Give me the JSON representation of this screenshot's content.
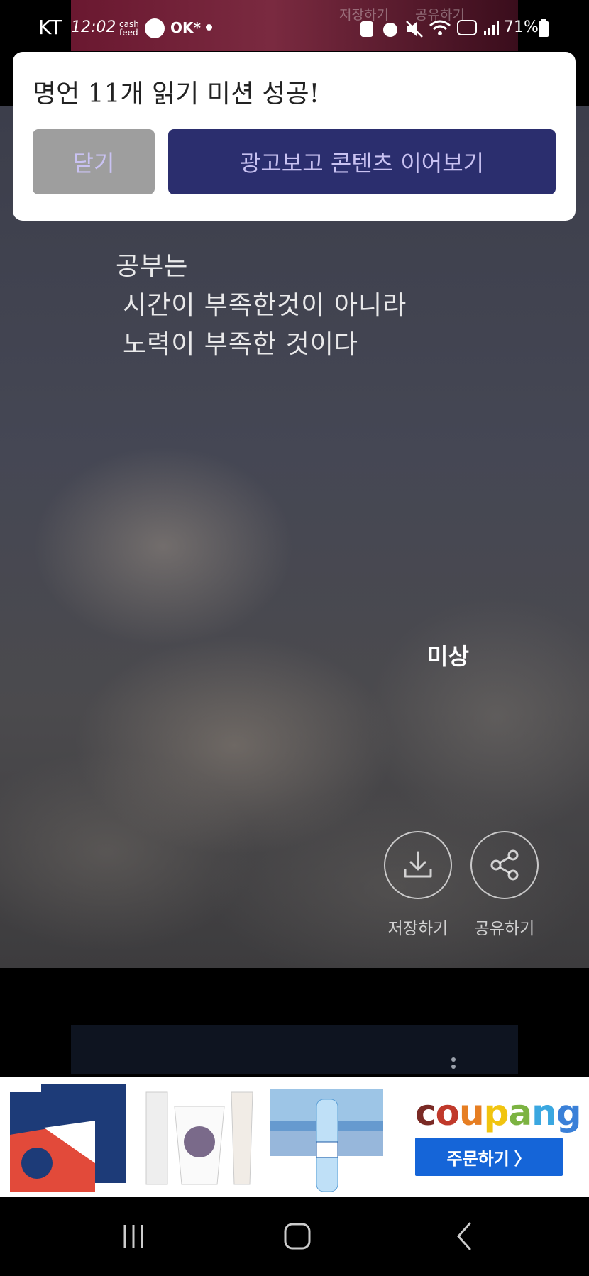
{
  "status_bar": {
    "carrier": "KT",
    "time": "12:02",
    "battery": "71%",
    "icons": [
      "cashfeed-icon",
      "ollock-icon",
      "ok-icon",
      "dot-icon",
      "download-icon",
      "alarm-icon",
      "mute-icon",
      "wifi-icon",
      "hd-icon",
      "signal-icon",
      "battery-icon"
    ]
  },
  "background_strip": {
    "save_label": "저장하기",
    "share_label": "공유하기"
  },
  "dialog": {
    "title": "명언 11개 읽기 미션 성공!",
    "close_label": "닫기",
    "ad_label": "광고보고 콘텐츠 이어보기"
  },
  "quote": {
    "lines": [
      "공부는",
      "시간이 부족한것이 아니라",
      "노력이 부족한 것이다"
    ],
    "author": "미상"
  },
  "actions": {
    "save_label": "저장하기",
    "share_label": "공유하기"
  },
  "ad": {
    "brand": "coupang",
    "order_label": "주문하기 〉",
    "products": [
      "copy-paper",
      "paper-cups",
      "water-bottles"
    ]
  },
  "nav": {
    "icons": [
      "recents-icon",
      "home-icon",
      "back-icon"
    ]
  },
  "colors": {
    "dialog_primary": "#2b2e6e",
    "dialog_secondary": "#9e9e9e",
    "button_text": "#c9c2f2",
    "coupang_blue": "#1565d8"
  }
}
